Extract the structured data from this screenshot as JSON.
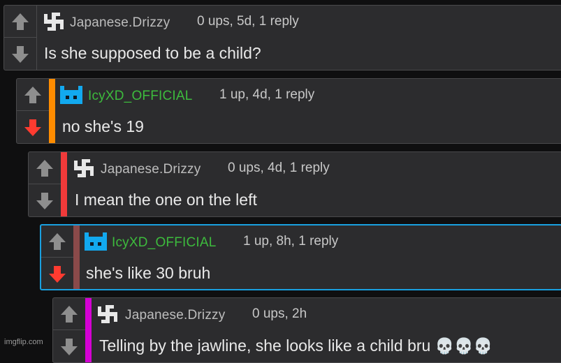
{
  "colors": {
    "background": "#0f0f10",
    "panel": "#2c2c2e",
    "green_user": "#3dbb3d",
    "gray_user": "#bdbdbd",
    "downvote_active": "#ff3b30",
    "highlight_border": "#19a0e0"
  },
  "comments": [
    {
      "username": "Japanese.Drizzy",
      "meta": "0 ups, 5d, 1 reply",
      "text": "Is she supposed to be a child?",
      "avatar": "swastika-avatar-icon",
      "upvote_icon": "arrow-up-icon",
      "downvote_icon": "arrow-down-icon"
    },
    {
      "username": "IcyXD_OFFICIAL",
      "meta": "1 up, 4d, 1 reply",
      "text": "no she's 19",
      "avatar": "blue-robot-avatar-icon",
      "upvote_icon": "arrow-up-icon",
      "downvote_icon": "arrow-down-active-icon",
      "bar_color": "#ff8c00"
    },
    {
      "username": "Japanese.Drizzy",
      "meta": "0 ups, 4d, 1 reply",
      "text": "I mean the one on the left",
      "avatar": "swastika-avatar-icon",
      "upvote_icon": "arrow-up-icon",
      "downvote_icon": "arrow-down-icon",
      "bar_color": "#f03a3a"
    },
    {
      "username": "IcyXD_OFFICIAL",
      "meta": "1 up, 8h, 1 reply",
      "text": "she's like 30 bruh",
      "avatar": "blue-robot-avatar-icon",
      "upvote_icon": "arrow-up-icon",
      "downvote_icon": "arrow-down-active-icon",
      "bar_color": "#8a4a4a"
    },
    {
      "username": "Japanese.Drizzy",
      "meta": "0 ups, 2h",
      "text": "Telling by the jawline, she looks like a child bru",
      "emoji": "💀💀💀",
      "avatar": "swastika-avatar-icon",
      "upvote_icon": "arrow-up-icon",
      "downvote_icon": "arrow-down-icon",
      "bar_color": "#d400d4"
    }
  ],
  "watermark": "imgflip.com"
}
